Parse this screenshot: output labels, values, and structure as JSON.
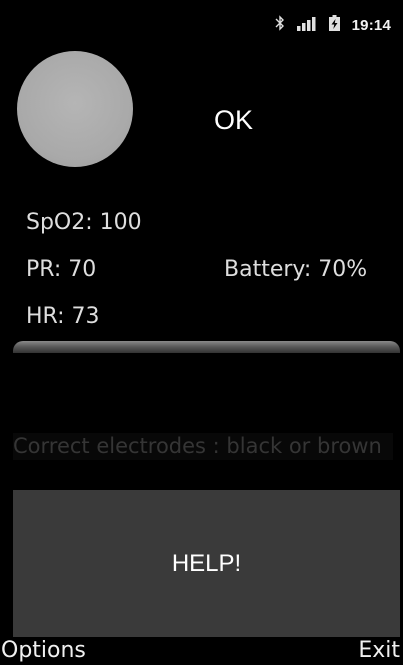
{
  "status_bar": {
    "time": "19:14",
    "icons": [
      "bluetooth-icon",
      "signal-icon",
      "battery-charging-icon"
    ]
  },
  "monitor": {
    "indicator_color": "#aaaaaa",
    "status": "OK",
    "spo2": "SpO2: 100",
    "pr": "PR: 70",
    "battery": "Battery: 70%",
    "hr": "HR: 73"
  },
  "instruction": "Correct electrodes : black or brown",
  "help_button": {
    "label": "HELP!"
  },
  "softkeys": {
    "left": "Options",
    "right": "Exit"
  }
}
